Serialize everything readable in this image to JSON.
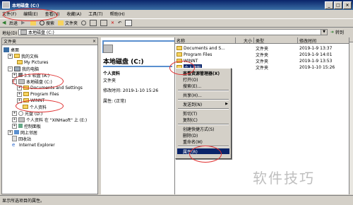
{
  "window": {
    "title": "本地磁盘 (C:)"
  },
  "menu": [
    "文件(F)",
    "编辑(E)",
    "查看(V)",
    "收藏(A)",
    "工具(T)",
    "帮助(H)"
  ],
  "toolbar": {
    "back": "后退",
    "search": "搜索",
    "folders": "文件夹"
  },
  "address": {
    "label": "地址(D)",
    "value": "本地磁盘 (C:)",
    "go": "转到"
  },
  "left_header": "文件夹",
  "tree": [
    "桌面",
    "我的文档",
    "My Pictures",
    "我的电脑",
    "3.5 软盘 (A:)",
    "本地磁盘 (C:)",
    "Documents and Settings",
    "Program Files",
    "WINNT",
    "个人资料",
    "光盘 (D:)",
    "个人资料 在 \"XINHaoft\" 上 (E:)",
    "控制面板",
    "网上邻居",
    "回收站",
    "Internet Explorer"
  ],
  "info": {
    "title": "本地磁盘 (C:)",
    "item_name": "个人资料",
    "item_type": "文件夹",
    "modified": "修改时间: 2019-1-10 15:26",
    "attributes": "属性: (正常)"
  },
  "columns": [
    "名称",
    "大小",
    "类型",
    "修改时间"
  ],
  "files": [
    {
      "name": "Documents and S...",
      "type": "文件夹",
      "date": "2019-1-9 13:37"
    },
    {
      "name": "Program Files",
      "type": "文件夹",
      "date": "2019-1-9 14:01"
    },
    {
      "name": "WINNT",
      "type": "文件夹",
      "date": "2019-1-9 13:53"
    },
    {
      "name": "个人资料",
      "type": "文件夹",
      "date": "2019-1-10 15:26"
    }
  ],
  "context_menu": {
    "items": [
      "查看资源管理器(X)",
      "打开(O)",
      "搜索(E)...",
      "共享(H)...",
      "发送到(N)",
      "剪切(T)",
      "复制(C)",
      "创建快捷方式(S)",
      "删除(D)",
      "重命名(M)",
      "属性(R)"
    ],
    "highlighted": "属性(R)"
  },
  "status": {
    "text": "显示所选项目的属性。"
  },
  "watermark": "软件技巧"
}
